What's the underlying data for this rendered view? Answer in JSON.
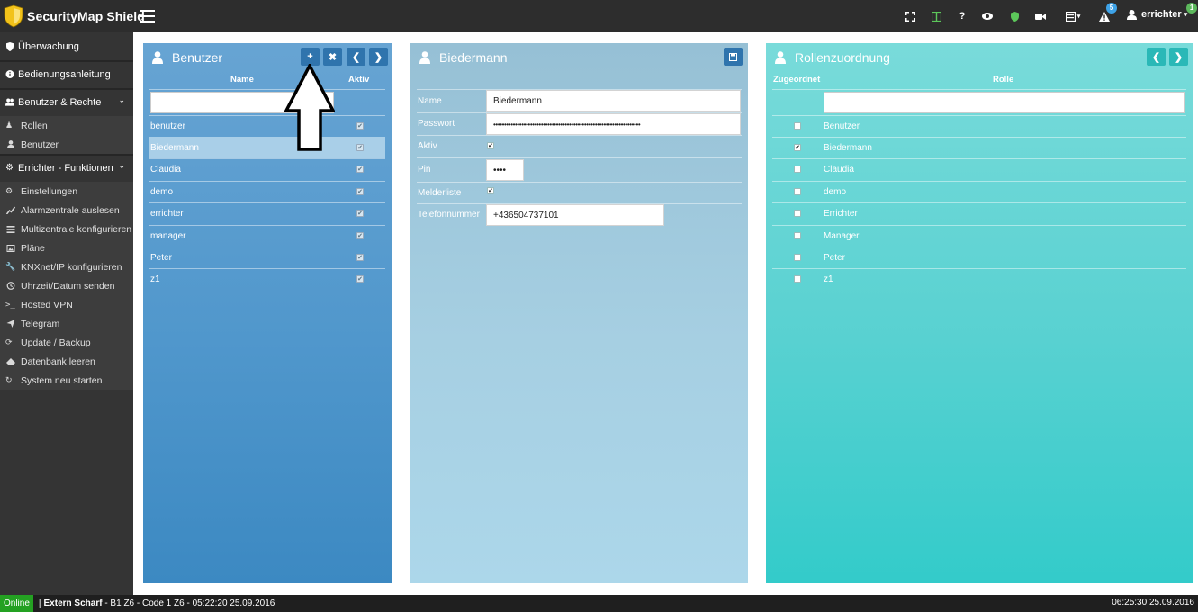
{
  "app": {
    "title": "SecurityMap Shield"
  },
  "colors": {
    "topbar": "#2d2d2d",
    "sidebar": "#343434",
    "online": "#24a122",
    "badge_blue": "#3ea3e8",
    "badge_green": "#5cb85c"
  },
  "topbar": {
    "icons": [
      "fullscreen-icon",
      "columns-icon",
      "help-icon",
      "eye-icon",
      "shield-icon",
      "camera-icon",
      "layout-icon",
      "warning-icon"
    ],
    "help_label": "?",
    "warning_badge": "5",
    "user_name": "errichter",
    "user_badge": "1"
  },
  "sidebar": {
    "items": [
      {
        "label": "Überwachung",
        "icon": "shield-icon"
      },
      {
        "label": "Bedienungsanleitung",
        "icon": "info-icon"
      },
      {
        "label": "Benutzer & Rechte",
        "icon": "users-icon"
      },
      {
        "label": "Rollen",
        "icon": "person-icon"
      },
      {
        "label": "Benutzer",
        "icon": "user-icon"
      },
      {
        "label": "Errichter - Funktionen",
        "icon": "cogs-icon"
      },
      {
        "label": "Einstellungen",
        "icon": "cogs-icon"
      },
      {
        "label": "Alarmzentrale auslesen",
        "icon": "chart-icon"
      },
      {
        "label": "Multizentrale konfigurieren",
        "icon": "list-icon"
      },
      {
        "label": "Pläne",
        "icon": "picture-icon"
      },
      {
        "label": "KNXnet/IP konfigurieren",
        "icon": "wrench-icon"
      },
      {
        "label": "Uhrzeit/Datum senden",
        "icon": "clock-icon"
      },
      {
        "label": "Hosted VPN",
        "icon": "terminal-icon"
      },
      {
        "label": "Telegram",
        "icon": "send-icon"
      },
      {
        "label": "Update / Backup",
        "icon": "refresh-icon"
      },
      {
        "label": "Datenbank leeren",
        "icon": "eraser-icon"
      },
      {
        "label": "System neu starten",
        "icon": "restart-icon"
      }
    ]
  },
  "users_panel": {
    "title": "Benutzer",
    "col_name": "Name",
    "col_active": "Aktiv",
    "filter_value": "",
    "rows": [
      {
        "name": "benutzer",
        "active": true
      },
      {
        "name": "Biedermann",
        "active": true,
        "selected": true
      },
      {
        "name": "Claudia",
        "active": true
      },
      {
        "name": "demo",
        "active": true
      },
      {
        "name": "errichter",
        "active": true
      },
      {
        "name": "manager",
        "active": true
      },
      {
        "name": "Peter",
        "active": true
      },
      {
        "name": "z1",
        "active": true
      }
    ]
  },
  "detail_panel": {
    "title": "Biedermann",
    "fields": {
      "name_label": "Name",
      "name_value": "Biedermann",
      "password_label": "Passwort",
      "password_value": "••••••••••••••••••••••••••••••••••••••••••••••••••••••••••••••••••••",
      "active_label": "Aktiv",
      "active_value": true,
      "pin_label": "Pin",
      "pin_value": "••••",
      "melder_label": "Melderliste",
      "melder_value": true,
      "phone_label": "Telefonnummer",
      "phone_value": "+436504737101"
    }
  },
  "roles_panel": {
    "title": "Rollenzuordnung",
    "col_assigned": "Zugeordnet",
    "col_role": "Rolle",
    "filter_value": "",
    "rows": [
      {
        "role": "Benutzer",
        "assigned": false
      },
      {
        "role": "Biedermann",
        "assigned": true
      },
      {
        "role": "Claudia",
        "assigned": false
      },
      {
        "role": "demo",
        "assigned": false
      },
      {
        "role": "Errichter",
        "assigned": false
      },
      {
        "role": "Manager",
        "assigned": false
      },
      {
        "role": "Peter",
        "assigned": false
      },
      {
        "role": "z1",
        "assigned": false
      }
    ]
  },
  "statusbar": {
    "online": "Online",
    "separator": "|",
    "event_bold": "Extern Scharf",
    "event_detail": " - B1 Z6 - Code 1 Z6 - 05:22:20 25.09.2016",
    "time": "06:25:30 25.09.2016"
  }
}
